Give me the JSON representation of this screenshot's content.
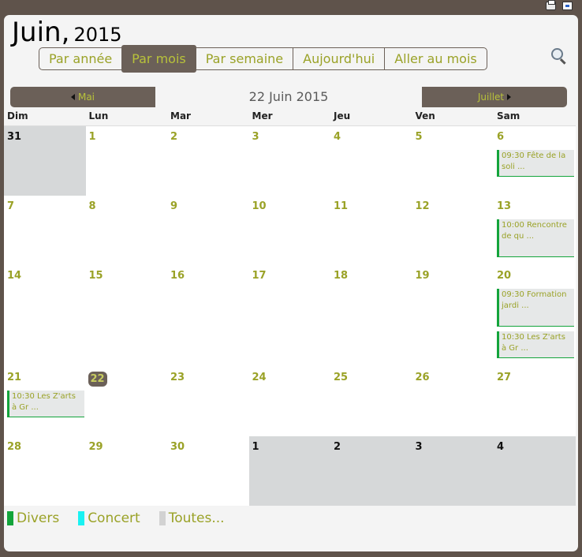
{
  "header": {
    "month": "Juin,",
    "year": "2015"
  },
  "views": [
    "Par année",
    "Par mois",
    "Par semaine",
    "Aujourd'hui",
    "Aller au mois"
  ],
  "active_view_index": 1,
  "nav": {
    "prev": "Mai",
    "current": "22 Juin 2015",
    "next": "Juillet"
  },
  "day_names": [
    "Dim",
    "Lun",
    "Mar",
    "Mer",
    "Jeu",
    "Ven",
    "Sam"
  ],
  "weeks": [
    {
      "days": [
        {
          "num": "31",
          "other": true
        },
        {
          "num": "1"
        },
        {
          "num": "2"
        },
        {
          "num": "3"
        },
        {
          "num": "4"
        },
        {
          "num": "5"
        },
        {
          "num": "6",
          "events": [
            {
              "text": "09:30 Fête de la soli ..."
            }
          ]
        }
      ]
    },
    {
      "days": [
        {
          "num": "7"
        },
        {
          "num": "8"
        },
        {
          "num": "9"
        },
        {
          "num": "10"
        },
        {
          "num": "11"
        },
        {
          "num": "12"
        },
        {
          "num": "13",
          "events": [
            {
              "text": "10:00 Rencontre de qu ..."
            }
          ]
        }
      ]
    },
    {
      "days": [
        {
          "num": "14"
        },
        {
          "num": "15"
        },
        {
          "num": "16"
        },
        {
          "num": "17"
        },
        {
          "num": "18"
        },
        {
          "num": "19"
        },
        {
          "num": "20",
          "events": [
            {
              "text": "09:30 Formation jardi ..."
            },
            {
              "text": "10:30 Les Z'arts à Gr ..."
            }
          ]
        }
      ]
    },
    {
      "days": [
        {
          "num": "21",
          "events": [
            {
              "text": "10:30 Les Z'arts à Gr ..."
            }
          ]
        },
        {
          "num": "22",
          "today": true
        },
        {
          "num": "23"
        },
        {
          "num": "24"
        },
        {
          "num": "25"
        },
        {
          "num": "26"
        },
        {
          "num": "27"
        }
      ]
    },
    {
      "days": [
        {
          "num": "28"
        },
        {
          "num": "29"
        },
        {
          "num": "30"
        },
        {
          "num": "1",
          "other": true
        },
        {
          "num": "2",
          "other": true
        },
        {
          "num": "3",
          "other": true
        },
        {
          "num": "4",
          "other": true
        }
      ]
    }
  ],
  "legend": [
    {
      "label": "Divers",
      "color": "#13a43b"
    },
    {
      "label": "Concert",
      "color": "#19f2f2"
    },
    {
      "label": "Toutes...",
      "color": "#d2d2d2"
    }
  ],
  "icons": {
    "print": "printer-icon",
    "mail": "email-icon",
    "search": "search-icon"
  }
}
